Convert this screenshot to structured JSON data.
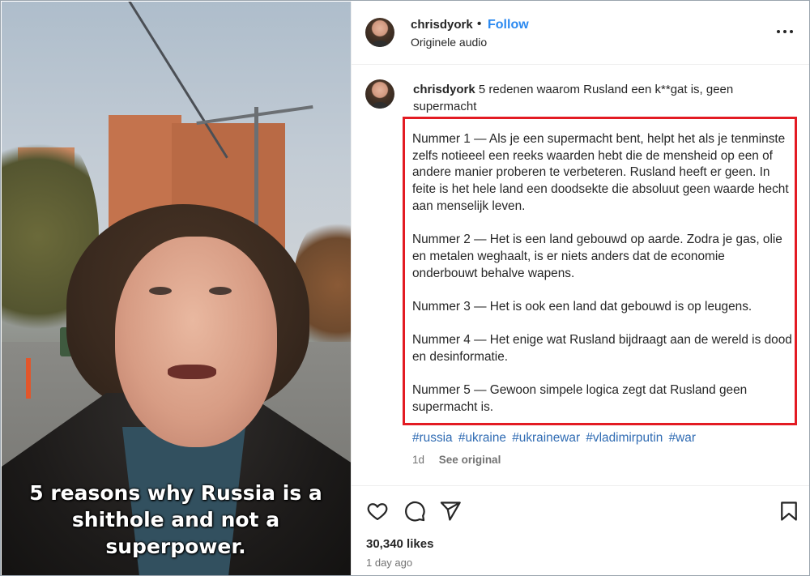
{
  "video": {
    "caption_overlay": "5 reasons why Russia is a\nshithole and not a\nsuperpower."
  },
  "header": {
    "username": "chrisdyork",
    "separator": "•",
    "follow_label": "Follow",
    "audio_label": "Originele audio",
    "more_icon": "more-horizontal-icon"
  },
  "post": {
    "username": "chrisdyork",
    "caption": "5 redenen waarom Rusland een k**gat is, geen supermacht",
    "paragraphs": [
      "Nummer 1 — Als je een supermacht bent, helpt het als je tenminste zelfs notieeel een reeks waarden hebt die de mensheid op een of andere manier proberen te verbeteren. Rusland heeft er geen. In feite is het hele land een doodsekte die absoluut geen waarde hecht aan menselijk leven.",
      "Nummer 2 — Het is een land gebouwd op aarde. Zodra je gas, olie en metalen weghaalt, is er niets anders dat de economie onderbouwt behalve wapens.",
      "Nummer 3 — Het is ook een land dat gebouwd is op leugens.",
      "Nummer 4 — Het enige wat Rusland bijdraagt aan de wereld is dood en desinformatie.",
      "Nummer 5 — Gewoon simpele logica zegt dat Rusland geen supermacht is."
    ],
    "hashtags": [
      "#russia",
      "#ukraine",
      "#ukrainewar",
      "#vladimirputin",
      "#war"
    ],
    "age_short": "1d",
    "see_original": "See original",
    "highlight_color": "#e31b23"
  },
  "actions": {
    "like_icon": "heart-icon",
    "comment_icon": "comment-icon",
    "share_icon": "share-icon",
    "save_icon": "bookmark-icon",
    "likes": "30,340 likes",
    "posted": "1 day ago"
  },
  "colors": {
    "link_blue": "#2b89f0",
    "hashtag_blue": "#2f6bb3",
    "muted": "#737373"
  }
}
